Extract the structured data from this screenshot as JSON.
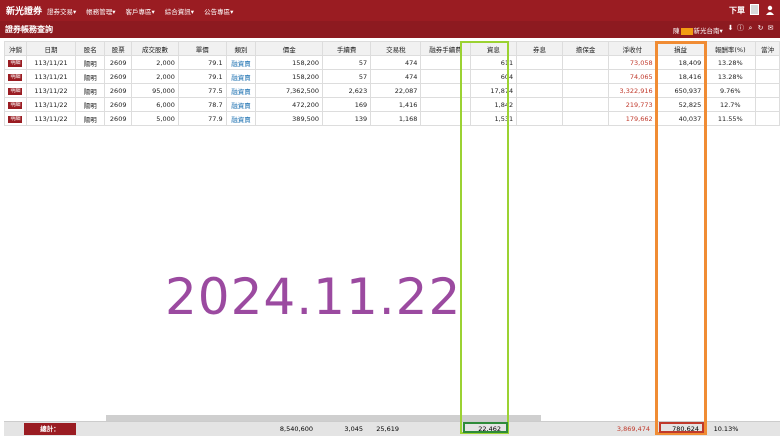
{
  "app": {
    "brand": "新光證券",
    "order_label": "下單"
  },
  "menu": [
    {
      "label": "證券交易▾"
    },
    {
      "label": "帳務管理▾"
    },
    {
      "label": "客戶專區▾"
    },
    {
      "label": "綜合資訊▾"
    },
    {
      "label": "公告專區▾"
    }
  ],
  "subheader": {
    "title": "證券帳務查詢",
    "account_prefix": "陳",
    "account_suffix": "新光台南▾"
  },
  "table": {
    "headers": [
      "沖銷",
      "日期",
      "股名",
      "股票",
      "成交股數",
      "單價",
      "類別",
      "價金",
      "手續費",
      "交易稅",
      "融券手續費",
      "資息",
      "券息",
      "擔保金",
      "淨收付",
      "損益",
      "報酬率(%)",
      "當沖"
    ],
    "detail_label": "明細",
    "rows": [
      {
        "date": "113/11/21",
        "name": "陽明",
        "code": "2609",
        "qty": "2,000",
        "price": "79.1",
        "type": "融資賣",
        "amount": "158,200",
        "fee": "57",
        "tax": "474",
        "ss_fee": "",
        "interest": "611",
        "bond_interest": "",
        "collateral": "",
        "net": "73,058",
        "pl": "18,409",
        "roi": "13.28%"
      },
      {
        "date": "113/11/21",
        "name": "陽明",
        "code": "2609",
        "qty": "2,000",
        "price": "79.1",
        "type": "融資賣",
        "amount": "158,200",
        "fee": "57",
        "tax": "474",
        "ss_fee": "",
        "interest": "604",
        "bond_interest": "",
        "collateral": "",
        "net": "74,065",
        "pl": "18,416",
        "roi": "13.28%"
      },
      {
        "date": "113/11/22",
        "name": "陽明",
        "code": "2609",
        "qty": "95,000",
        "price": "77.5",
        "type": "融資賣",
        "amount": "7,362,500",
        "fee": "2,623",
        "tax": "22,087",
        "ss_fee": "",
        "interest": "17,874",
        "bond_interest": "",
        "collateral": "",
        "net": "3,322,916",
        "pl": "650,937",
        "roi": "9.76%"
      },
      {
        "date": "113/11/22",
        "name": "陽明",
        "code": "2609",
        "qty": "6,000",
        "price": "78.7",
        "type": "融資賣",
        "amount": "472,200",
        "fee": "169",
        "tax": "1,416",
        "ss_fee": "",
        "interest": "1,842",
        "bond_interest": "",
        "collateral": "",
        "net": "219,773",
        "pl": "52,825",
        "roi": "12.7%"
      },
      {
        "date": "113/11/22",
        "name": "陽明",
        "code": "2609",
        "qty": "5,000",
        "price": "77.9",
        "type": "融資賣",
        "amount": "389,500",
        "fee": "139",
        "tax": "1,168",
        "ss_fee": "",
        "interest": "1,531",
        "bond_interest": "",
        "collateral": "",
        "net": "179,662",
        "pl": "40,037",
        "roi": "11.55%"
      }
    ]
  },
  "overlay": {
    "date": "2024.11.22"
  },
  "totals": {
    "label": "總計：",
    "amount": "8,540,600",
    "fee": "3,045",
    "tax": "25,619",
    "interest": "22,462",
    "net": "3,869,474",
    "pl": "780,624",
    "roi": "10.13%"
  },
  "colors": {
    "brand": "#9a1c22",
    "highlight_green": "#9bd232",
    "highlight_orange": "#f08c34",
    "date_overlay": "#9b4aa0"
  },
  "icons": [
    "download-icon",
    "info-icon",
    "search-icon",
    "refresh-icon",
    "mail-icon",
    "user-icon",
    "flag-icon"
  ]
}
